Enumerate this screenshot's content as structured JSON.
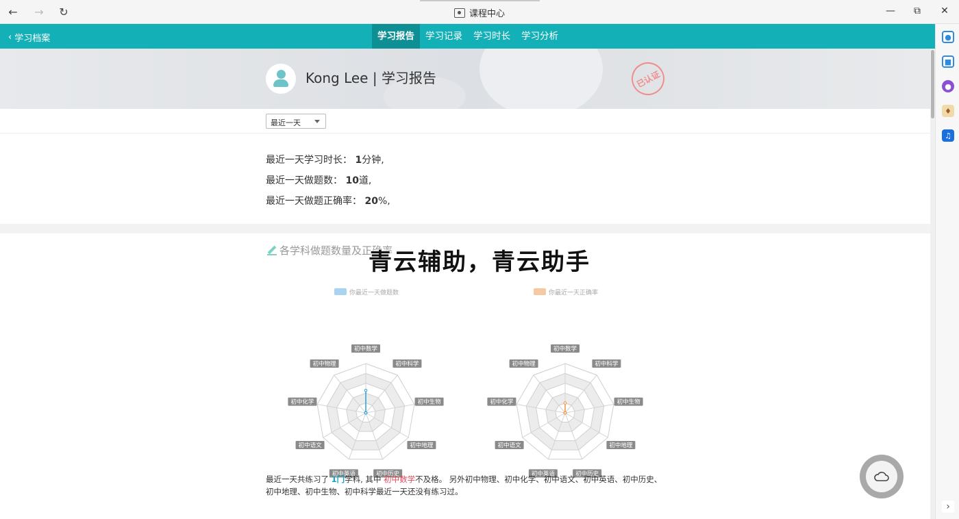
{
  "window": {
    "title": "课程中心",
    "back_icon": "arrow-left-icon",
    "forward_icon": "arrow-right-icon",
    "refresh_icon": "refresh-icon"
  },
  "nav": {
    "back_label": "学习档案",
    "tabs": [
      {
        "label": "学习报告",
        "active": true
      },
      {
        "label": "学习记录",
        "active": false
      },
      {
        "label": "学习时长",
        "active": false
      },
      {
        "label": "学习分析",
        "active": false
      }
    ]
  },
  "header": {
    "title": "Kong Lee | 学习报告",
    "stamp": "已认证"
  },
  "filter": {
    "selected": "最近一天"
  },
  "summary": {
    "duration_label": "最近一天学习时长：",
    "duration_value": "1",
    "duration_unit": "分钟,",
    "questions_label": "最近一天做题数：",
    "questions_value": "10",
    "questions_unit": "道,",
    "accuracy_label": "最近一天做题正确率：",
    "accuracy_value": "20",
    "accuracy_unit": "%,"
  },
  "section": {
    "title": "各学科做题数量及正确率"
  },
  "chart_data": [
    {
      "type": "radar",
      "legend": "你最近一天做题数",
      "color": "#2a9fd6",
      "legend_color": "#a8d4f2",
      "categories": [
        "初中数学",
        "初中科学",
        "初中生物",
        "初中地理",
        "初中历史",
        "初中英语",
        "初中语文",
        "初中化学",
        "初中物理"
      ],
      "values": [
        10,
        0,
        0,
        0,
        0,
        0,
        0,
        0,
        0
      ],
      "max": 22
    },
    {
      "type": "radar",
      "legend": "你最近一天正确率",
      "color": "#f0903a",
      "legend_color": "#f6c9a3",
      "categories": [
        "初中数学",
        "初中科学",
        "初中生物",
        "初中地理",
        "初中历史",
        "初中英语",
        "初中语文",
        "初中化学",
        "初中物理"
      ],
      "values": [
        20,
        0,
        0,
        0,
        0,
        0,
        0,
        0,
        0
      ],
      "max": 100
    }
  ],
  "bottom": {
    "p1": "最近一天共练习了 ",
    "count": "1门",
    "p2": "学科, 其中 ",
    "failed": "初中数学",
    "p3": "不及格。 另外初中物理、初中化学、初中语文、初中英语、初中历史、初中地理、初中生物、初中科学最近一天还没有练习过。"
  },
  "watermark": "青云辅助，青云助手",
  "float_button_icon": "cloud-icon"
}
